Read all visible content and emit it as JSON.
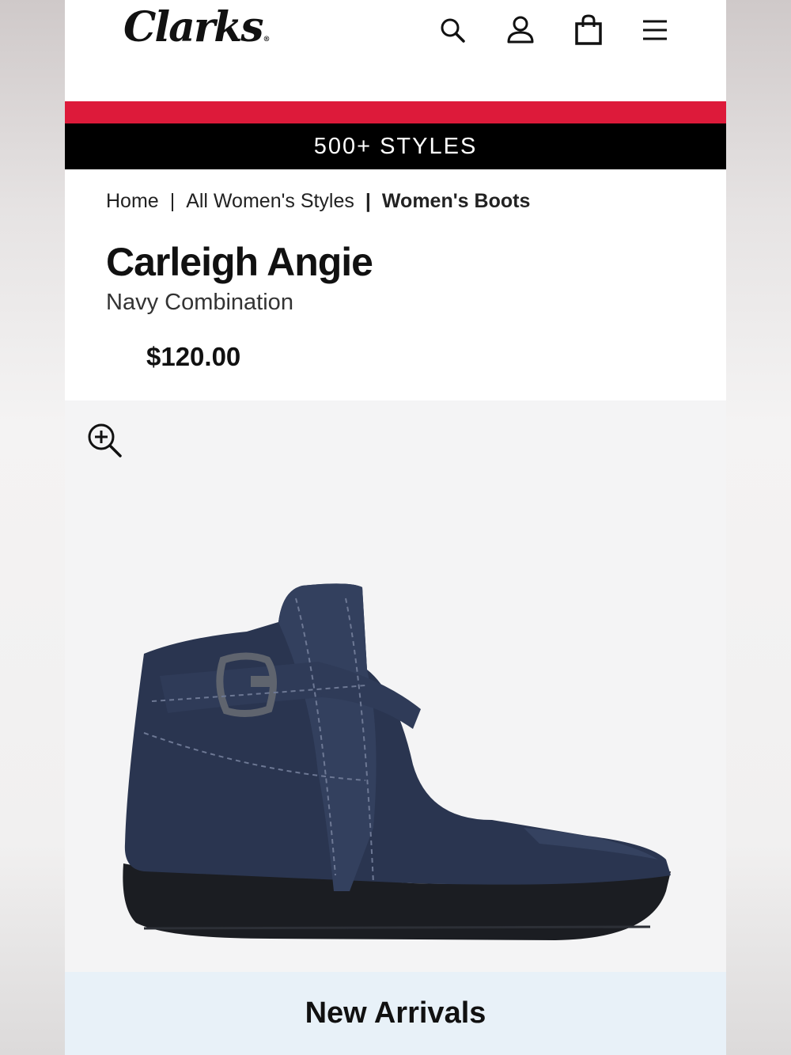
{
  "brand": {
    "logo_text": "Clarks",
    "logo_mark": "®"
  },
  "header": {
    "icons": [
      "search-icon",
      "account-icon",
      "shopping-bag-icon",
      "menu-icon"
    ]
  },
  "promo": {
    "text": "500+ STYLES",
    "accent_color": "#dd1a3a"
  },
  "breadcrumb": {
    "items": [
      "Home",
      "All Women's Styles",
      "Women's Boots"
    ],
    "separator": "|"
  },
  "product": {
    "name": "Carleigh Angie",
    "color": "Navy Combination",
    "price": "$120.00",
    "image_alt": "Carleigh Angie navy ankle boot with buckle strap"
  },
  "gallery": {
    "zoom_icon": "zoom-in-icon"
  },
  "banner": {
    "text": "New Arrivals"
  }
}
